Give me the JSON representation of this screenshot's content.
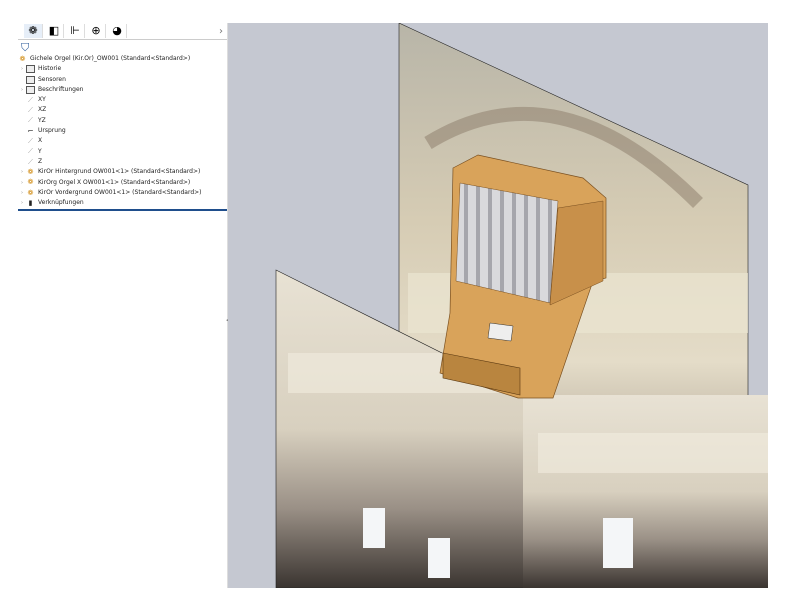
{
  "tabs": [
    {
      "name": "feature-manager",
      "glyph": "❁"
    },
    {
      "name": "property-manager",
      "glyph": "◧"
    },
    {
      "name": "configuration-manager",
      "glyph": "⊩"
    },
    {
      "name": "dimxpert",
      "glyph": "⊕"
    },
    {
      "name": "display-manager",
      "glyph": "◕"
    }
  ],
  "more": "›",
  "filter": "⛉",
  "tree": {
    "root": "Gichele Orgel (Kir.Or)_OW001 (Standard<Standard>)",
    "items": [
      {
        "label": "Historie",
        "type": "folder",
        "exp": "›"
      },
      {
        "label": "Sensoren",
        "type": "folder",
        "exp": ""
      },
      {
        "label": "Beschriftungen",
        "type": "folder",
        "exp": "›"
      },
      {
        "label": "XY",
        "type": "plane",
        "exp": ""
      },
      {
        "label": "XZ",
        "type": "plane",
        "exp": ""
      },
      {
        "label": "YZ",
        "type": "plane",
        "exp": ""
      },
      {
        "label": "Ursprung",
        "type": "origin",
        "exp": ""
      },
      {
        "label": "X",
        "type": "plane",
        "exp": ""
      },
      {
        "label": "Y",
        "type": "plane",
        "exp": ""
      },
      {
        "label": "Z",
        "type": "plane",
        "exp": ""
      },
      {
        "label": "KirOr Hintergrund OW001<1> (Standard<Standard>)",
        "type": "asm",
        "exp": "›"
      },
      {
        "label": "KirOrg Orgel X OW001<1> (Standard<Standard>)",
        "type": "asm",
        "exp": "›"
      },
      {
        "label": "KirOr Vordergrund OW001<1> (Standard<Standard>)",
        "type": "asm",
        "exp": "›"
      },
      {
        "label": "Verknüpfungen",
        "type": "mates",
        "exp": "›"
      }
    ]
  },
  "colors": {
    "canvas": "#c5c8d1",
    "accent": "#1f4e8c",
    "wood": "#d9a35a"
  }
}
